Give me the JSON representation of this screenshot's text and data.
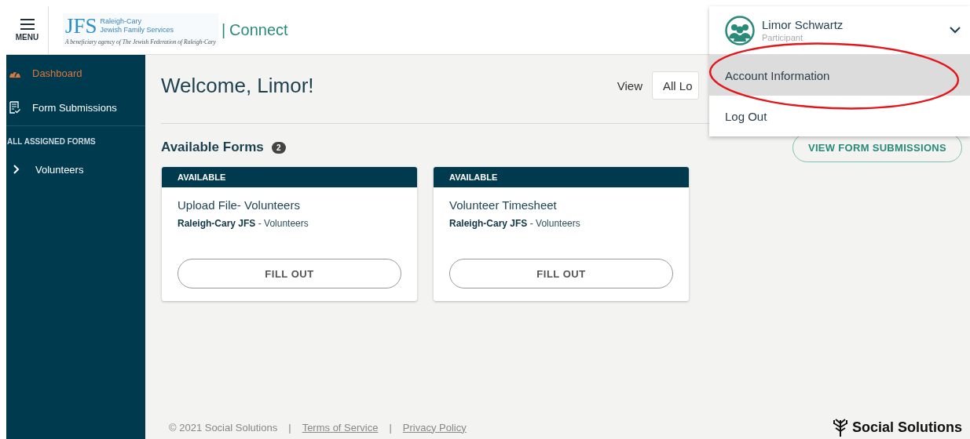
{
  "header": {
    "menu_label": "MENU",
    "logo": {
      "mark": "JFS",
      "line_1": "Raleigh-Cary",
      "line_2": "Jewish Family Services",
      "tagline": "A beneficiary agency of The Jewish Federation of Raleigh-Cary"
    },
    "separator": "|",
    "app_name": "Connect"
  },
  "sidebar": {
    "items": [
      {
        "label": "Dashboard",
        "kind": "dashboard",
        "selected": true
      },
      {
        "label": "Form Submissions",
        "kind": "form",
        "selected": false
      }
    ],
    "section_title": "ALL ASSIGNED FORMS",
    "forms": [
      {
        "label": "Volunteers",
        "expanded": false
      }
    ]
  },
  "main": {
    "title": "Welcome, Limor!",
    "view_label": "View",
    "view_value": "All Lo",
    "section_title": "Available Forms",
    "count": "2",
    "view_all_button": "VIEW FORM SUBMISSIONS",
    "cards": [
      {
        "status": "AVAILABLE",
        "title": "Upload File- Volunteers",
        "subtitle": "**Raleigh-Cary JFS** - Volunteers",
        "button": "FILL OUT"
      },
      {
        "status": "AVAILABLE",
        "title": "Volunteer Timesheet",
        "subtitle": "**Raleigh-Cary JFS** - Volunteers",
        "button": "FILL OUT"
      }
    ]
  },
  "user_menu": {
    "name": "Limor Schwartz",
    "role": "Participant",
    "items": [
      {
        "label": "Account Information",
        "selected": true
      },
      {
        "label": "Log Out",
        "selected": false
      }
    ]
  },
  "footer": {
    "items": [
      {
        "kind": "text",
        "label": "© 2021 Social Solutions"
      },
      {
        "kind": "separator",
        "label": "|"
      },
      {
        "kind": "link",
        "label": "Terms of Service"
      },
      {
        "kind": "separator",
        "label": "|"
      },
      {
        "kind": "link",
        "label": "Privacy Policy"
      }
    ],
    "brand": "Social Solutions"
  },
  "annotation": {
    "kind": "ellipse"
  }
}
